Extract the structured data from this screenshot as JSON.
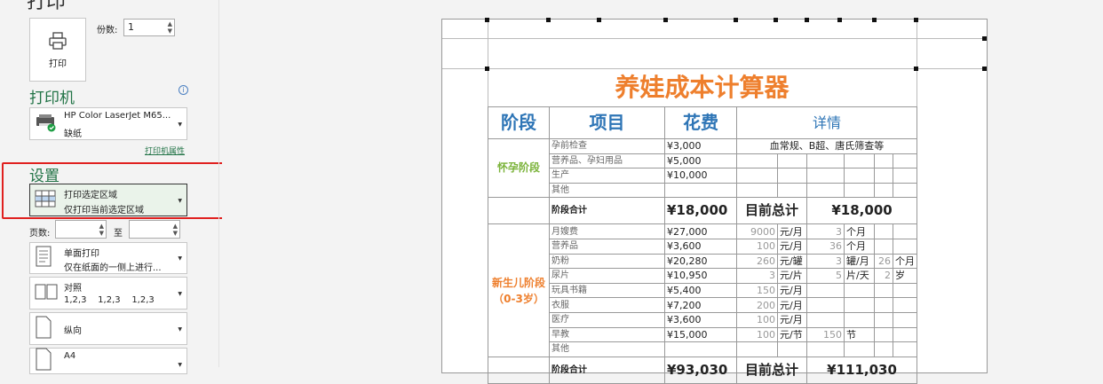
{
  "page": {
    "heading": "打印"
  },
  "print_button": {
    "label": "打印"
  },
  "copies": {
    "label": "份数:",
    "value": "1"
  },
  "printer": {
    "section_title": "打印机",
    "name": "HP Color LaserJet M65...",
    "status": "缺纸",
    "properties_link": "打印机属性"
  },
  "settings": {
    "section_title": "设置",
    "print_area": {
      "title": "打印选定区域",
      "subtitle": "仅打印当前选定区域"
    },
    "pages_label": "页数:",
    "to_label": "至",
    "sides": {
      "title": "单面打印",
      "subtitle": "仅在纸面的一侧上进行..."
    },
    "collate": {
      "title": "对照",
      "subtitle": "1,2,3    1,2,3    1,2,3"
    },
    "orientation": {
      "title": "纵向"
    },
    "paper_size": {
      "title": "A4"
    }
  },
  "preview": {
    "sheet_title": "养娃成本计算器",
    "headers": {
      "stage": "阶段",
      "item": "项目",
      "cost": "花费",
      "detail": "详情"
    },
    "pregnancy": {
      "stage": "怀孕阶段",
      "rows": [
        {
          "item": "孕前检查",
          "cost": "¥3,000",
          "detail": "血常规、B超、唐氏筛查等"
        },
        {
          "item": "营养品、孕妇用品",
          "cost": "¥5,000"
        },
        {
          "item": "生产",
          "cost": "¥10,000"
        },
        {
          "item": "其他",
          "cost": ""
        }
      ],
      "total_label": "阶段合计",
      "total_value": "¥18,000",
      "running_label": "目前总计",
      "running_value": "¥18,000"
    },
    "newborn": {
      "stage_line1": "新生儿阶段",
      "stage_line2": "（0-3岁）",
      "rows": [
        {
          "item": "月嫂费",
          "cost": "¥27,000",
          "q1": "9000",
          "u1": "元/月",
          "q2": "3",
          "u2": "个月",
          "q3": "",
          "u3": ""
        },
        {
          "item": "营养品",
          "cost": "¥3,600",
          "q1": "100",
          "u1": "元/月",
          "q2": "36",
          "u2": "个月",
          "q3": "",
          "u3": ""
        },
        {
          "item": "奶粉",
          "cost": "¥20,280",
          "q1": "260",
          "u1": "元/罐",
          "q2": "3",
          "u2": "罐/月",
          "q3": "26",
          "u3": "个月"
        },
        {
          "item": "尿片",
          "cost": "¥10,950",
          "q1": "3",
          "u1": "元/片",
          "q2": "5",
          "u2": "片/天",
          "q3": "2",
          "u3": "岁"
        },
        {
          "item": "玩具书籍",
          "cost": "¥5,400",
          "q1": "150",
          "u1": "元/月",
          "q2": "",
          "u2": "",
          "q3": "",
          "u3": ""
        },
        {
          "item": "衣服",
          "cost": "¥7,200",
          "q1": "200",
          "u1": "元/月",
          "q2": "",
          "u2": "",
          "q3": "",
          "u3": ""
        },
        {
          "item": "医疗",
          "cost": "¥3,600",
          "q1": "100",
          "u1": "元/月",
          "q2": "",
          "u2": "",
          "q3": "",
          "u3": ""
        },
        {
          "item": "早教",
          "cost": "¥15,000",
          "q1": "100",
          "u1": "元/节",
          "q2": "150",
          "u2": "节",
          "q3": "",
          "u3": ""
        },
        {
          "item": "其他",
          "cost": "",
          "q1": "",
          "u1": "",
          "q2": "",
          "u2": "",
          "q3": "",
          "u3": ""
        }
      ],
      "total_label": "阶段合计",
      "total_value": "¥93,030",
      "running_label": "目前总计",
      "running_value": "¥111,030"
    }
  }
}
